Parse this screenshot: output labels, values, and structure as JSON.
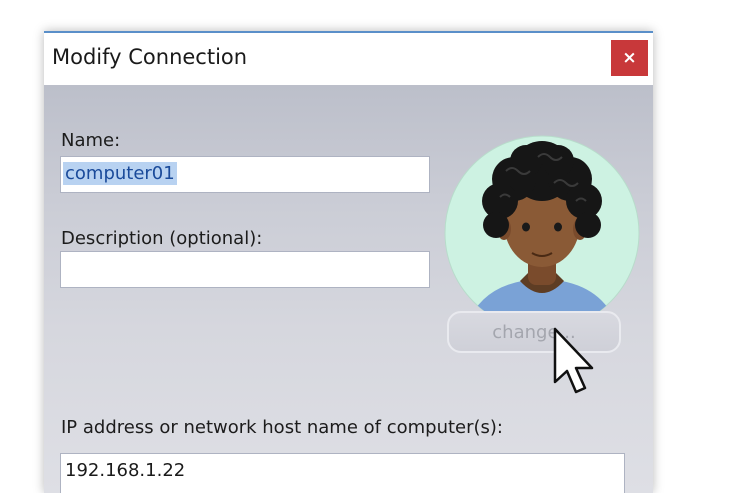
{
  "dialog": {
    "title": "Modify Connection",
    "close_label": "×",
    "close_color": "#c8383a",
    "name_label": "Name:",
    "name_value": "computer01",
    "description_label": "Description (optional):",
    "description_value": "",
    "change_label": "change...",
    "ip_label": "IP address or network host name of computer(s):",
    "ip_value": "192.168.1.22",
    "avatar_icon": "person-avatar-icon",
    "cursor_icon": "mouse-pointer-icon"
  }
}
